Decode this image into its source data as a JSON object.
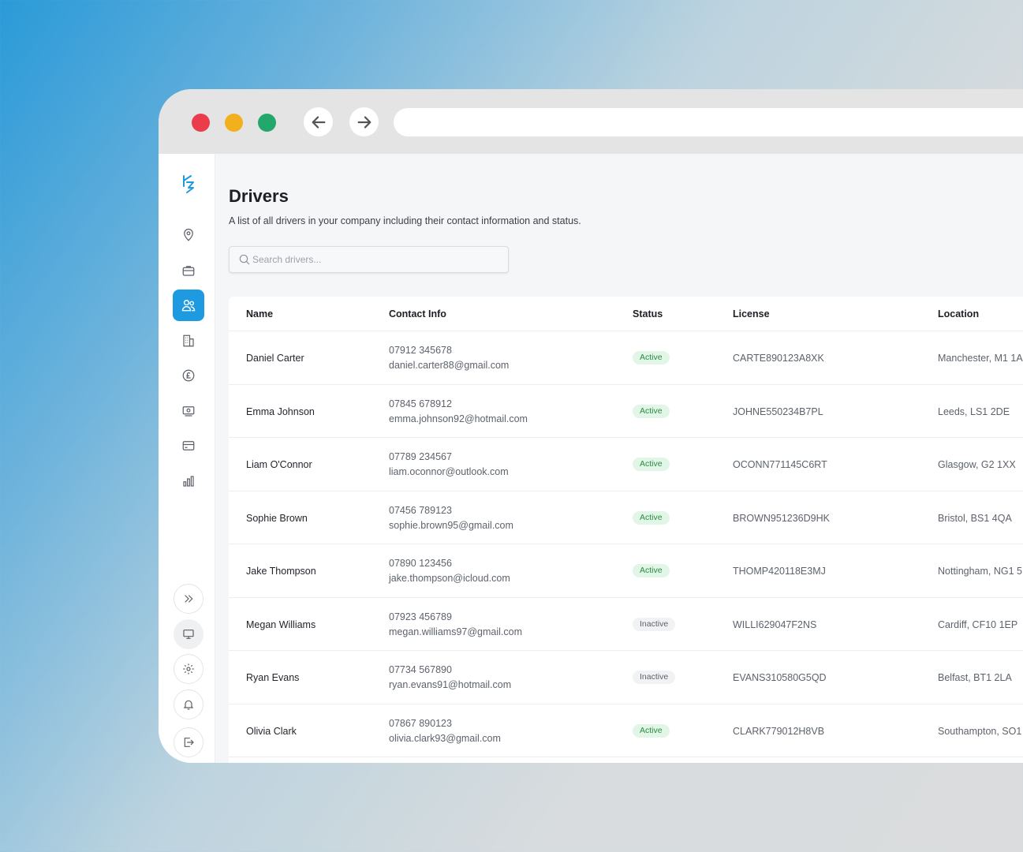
{
  "page": {
    "title": "Drivers",
    "subtitle": "A list of all drivers in your company including their contact information and status."
  },
  "search": {
    "placeholder": "Search drivers..."
  },
  "icons": {
    "logo": "logo-icon",
    "sidebar": [
      "location-pin-icon",
      "briefcase-icon",
      "users-icon",
      "building-icon",
      "pound-icon",
      "money-icon",
      "credit-card-icon",
      "bar-chart-icon"
    ],
    "sidebar_bottom": [
      "chevrons-right-icon",
      "monitor-icon",
      "gear-icon",
      "bell-icon",
      "logout-icon"
    ]
  },
  "colors": {
    "accent": "#1e9be0",
    "active_badge": "#2a8b43",
    "active_badge_bg": "#e2f6e7"
  },
  "table": {
    "columns": [
      "Name",
      "Contact Info",
      "Status",
      "License",
      "Location"
    ],
    "rows": [
      {
        "name": "Daniel Carter",
        "phone": "07912 345678",
        "email": "daniel.carter88@gmail.com",
        "status": "Active",
        "license": "CARTE890123A8XK",
        "location": "Manchester, M1 1A"
      },
      {
        "name": "Emma Johnson",
        "phone": "07845 678912",
        "email": "emma.johnson92@hotmail.com",
        "status": "Active",
        "license": "JOHNE550234B7PL",
        "location": "Leeds, LS1 2DE"
      },
      {
        "name": "Liam O'Connor",
        "phone": "07789 234567",
        "email": "liam.oconnor@outlook.com",
        "status": "Active",
        "license": "OCONN771145C6RT",
        "location": "Glasgow, G2 1XX"
      },
      {
        "name": "Sophie Brown",
        "phone": "07456 789123",
        "email": "sophie.brown95@gmail.com",
        "status": "Active",
        "license": "BROWN951236D9HK",
        "location": "Bristol, BS1 4QA"
      },
      {
        "name": "Jake Thompson",
        "phone": "07890 123456",
        "email": "jake.thompson@icloud.com",
        "status": "Active",
        "license": "THOMP420118E3MJ",
        "location": "Nottingham, NG1 5"
      },
      {
        "name": "Megan Williams",
        "phone": "07923 456789",
        "email": "megan.williams97@gmail.com",
        "status": "Inactive",
        "license": "WILLI629047F2NS",
        "location": "Cardiff, CF10 1EP"
      },
      {
        "name": "Ryan Evans",
        "phone": "07734 567890",
        "email": "ryan.evans91@hotmail.com",
        "status": "Inactive",
        "license": "EVANS310580G5QD",
        "location": "Belfast, BT1 2LA"
      },
      {
        "name": "Olivia Clark",
        "phone": "07867 890123",
        "email": "olivia.clark93@gmail.com",
        "status": "Active",
        "license": "CLARK779012H8VB",
        "location": "Southampton, SO1"
      }
    ]
  }
}
